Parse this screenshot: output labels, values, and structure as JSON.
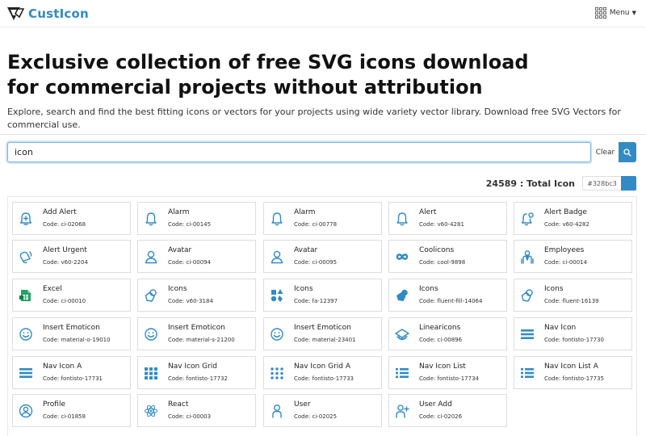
{
  "brand": {
    "name": "CustIcon",
    "accent": "#328bc3"
  },
  "nav": {
    "menu_label": "Menu"
  },
  "hero": {
    "headline_line1": "Exclusive collection of free SVG icons download",
    "headline_line2": "for commercial projects without attribution",
    "subtext": "Explore, search and find the best fitting icons or vectors for your projects using wide variety vector library. Download free SVG Vectors for commercial use."
  },
  "search": {
    "value": "icon",
    "clear_label": "Clear"
  },
  "results": {
    "total_text": "24589 : Total Icon",
    "color_value": "#328bc3"
  },
  "icons": [
    {
      "name": "Add Alert",
      "code": "Code: ci-02068",
      "icon": "add-alert-icon"
    },
    {
      "name": "Alarm",
      "code": "Code: ci-00145",
      "icon": "bell-icon"
    },
    {
      "name": "Alarm",
      "code": "Code: ci-00778",
      "icon": "bell-icon"
    },
    {
      "name": "Alert",
      "code": "Code: v60-4281",
      "icon": "bell-icon"
    },
    {
      "name": "Alert Badge",
      "code": "Code: v60-4282",
      "icon": "bell-badge-icon"
    },
    {
      "name": "Alert Urgent",
      "code": "Code: v60-2204",
      "icon": "bell-urgent-icon"
    },
    {
      "name": "Avatar",
      "code": "Code: ci-00094",
      "icon": "avatar-icon"
    },
    {
      "name": "Avatar",
      "code": "Code: ci-00095",
      "icon": "avatar-icon"
    },
    {
      "name": "Coolicons",
      "code": "Code: cool-9898",
      "icon": "infinity-icon"
    },
    {
      "name": "Employees",
      "code": "Code: ci-00014",
      "icon": "employees-icon"
    },
    {
      "name": "Excel",
      "code": "Code: ci-00010",
      "icon": "excel-icon"
    },
    {
      "name": "Icons",
      "code": "Code: v60-3184",
      "icon": "shapes-icon"
    },
    {
      "name": "Icons",
      "code": "Code: fa-12397",
      "icon": "shapes-solid-icon"
    },
    {
      "name": "Icons",
      "code": "Code: fluent-fill-14064",
      "icon": "shapes-fill-icon"
    },
    {
      "name": "Icons",
      "code": "Code: fluent-16139",
      "icon": "shapes-icon"
    },
    {
      "name": "Insert Emoticon",
      "code": "Code: material-o-19010",
      "icon": "emoticon-icon"
    },
    {
      "name": "Insert Emoticon",
      "code": "Code: material-s-21200",
      "icon": "emoticon-icon"
    },
    {
      "name": "Insert Emoticon",
      "code": "Code: material-23401",
      "icon": "emoticon-icon"
    },
    {
      "name": "Linearicons",
      "code": "Code: ci-00896",
      "icon": "linearicons-icon"
    },
    {
      "name": "Nav Icon",
      "code": "Code: fontisto-17730",
      "icon": "nav-bars-icon"
    },
    {
      "name": "Nav Icon A",
      "code": "Code: fontisto-17731",
      "icon": "nav-bars-icon"
    },
    {
      "name": "Nav Icon Grid",
      "code": "Code: fontisto-17732",
      "icon": "grid-squares-icon"
    },
    {
      "name": "Nav Icon Grid A",
      "code": "Code: fontisto-17733",
      "icon": "grid-dots-icon"
    },
    {
      "name": "Nav Icon List",
      "code": "Code: fontisto-17734",
      "icon": "nav-list-icon"
    },
    {
      "name": "Nav Icon List A",
      "code": "Code: fontisto-17735",
      "icon": "nav-list-icon"
    },
    {
      "name": "Profile",
      "code": "Code: ci-01858",
      "icon": "profile-icon"
    },
    {
      "name": "React",
      "code": "Code: ci-00003",
      "icon": "react-icon"
    },
    {
      "name": "User",
      "code": "Code: ci-02025",
      "icon": "user-icon"
    },
    {
      "name": "User Add",
      "code": "Code: ci-02026",
      "icon": "user-add-icon"
    }
  ]
}
